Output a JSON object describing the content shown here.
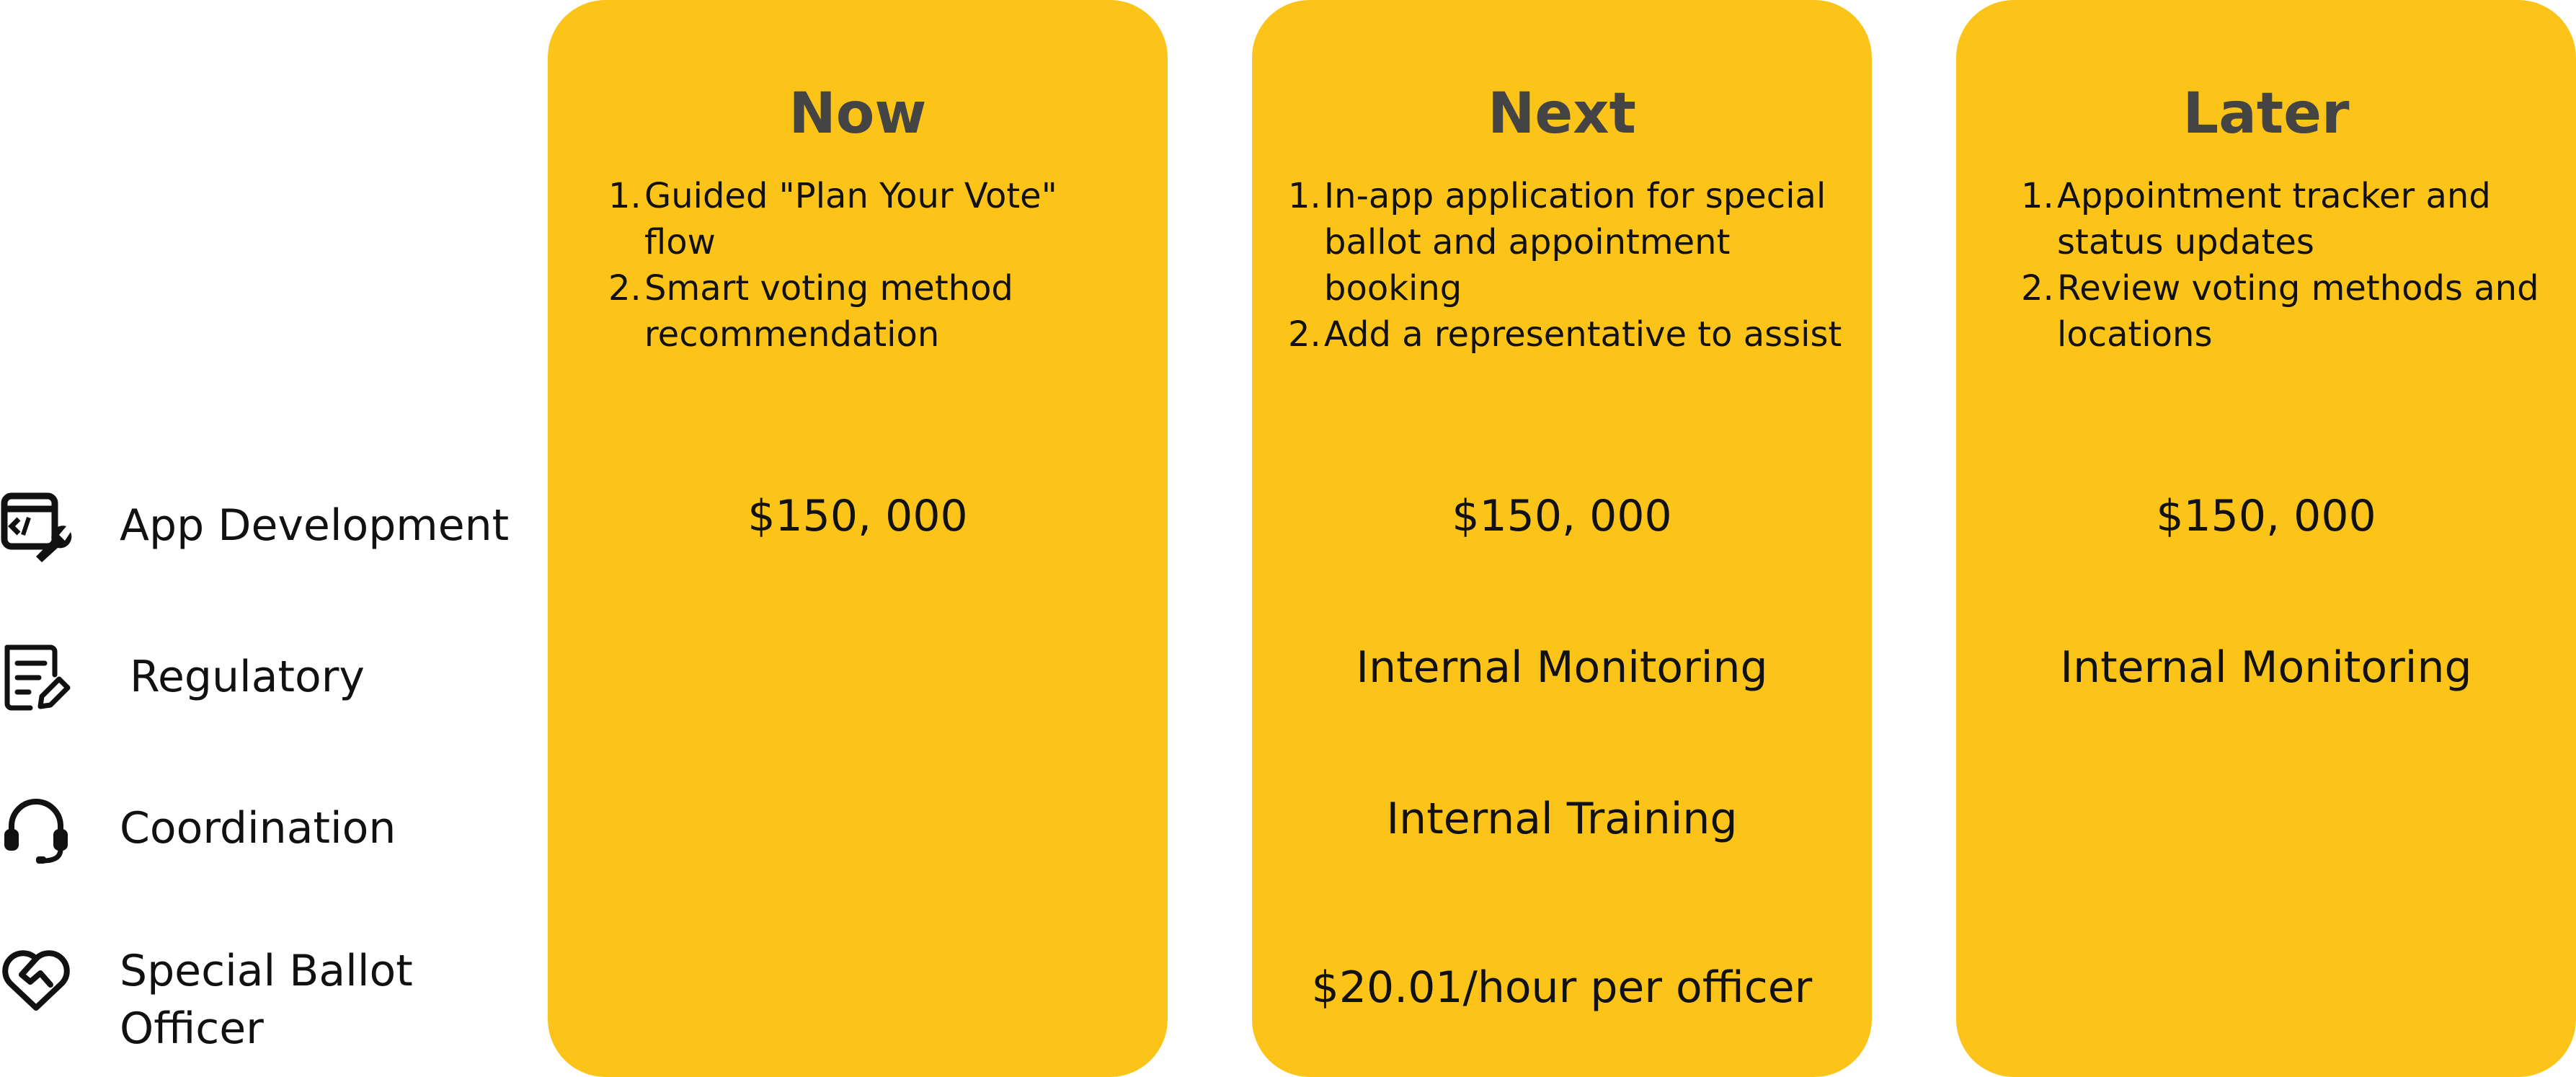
{
  "rows": [
    {
      "label": "App Development",
      "icon": "app-development-icon"
    },
    {
      "label": "Regulatory",
      "icon": "document-edit-icon"
    },
    {
      "label": "Coordination",
      "icon": "headset-icon"
    },
    {
      "label": "Special Ballot Officer",
      "label_line1": "Special Ballot",
      "label_line2": "Officer",
      "icon": "heart-handshake-icon"
    }
  ],
  "columns": [
    {
      "title": "Now",
      "items": [
        "Guided \"Plan Your Vote\" flow",
        "Smart voting method recommendation"
      ],
      "app_development": "$150, 000",
      "regulatory": "",
      "coordination": "",
      "special_ballot_officer": ""
    },
    {
      "title": "Next",
      "items": [
        "In-app application for special ballot and appointment booking",
        "Add a representative to assist"
      ],
      "app_development": "$150, 000",
      "regulatory": "Internal Monitoring",
      "coordination": "Internal Training",
      "special_ballot_officer": "$20.01/hour per officer"
    },
    {
      "title": "Later",
      "items": [
        "Appointment tracker and status updates",
        "Review voting methods and locations"
      ],
      "app_development": "$150, 000",
      "regulatory": "Internal Monitoring",
      "coordination": "",
      "special_ballot_officer": ""
    }
  ],
  "colors": {
    "card": "#FCC419",
    "title": "#444444",
    "text": "#111111"
  }
}
